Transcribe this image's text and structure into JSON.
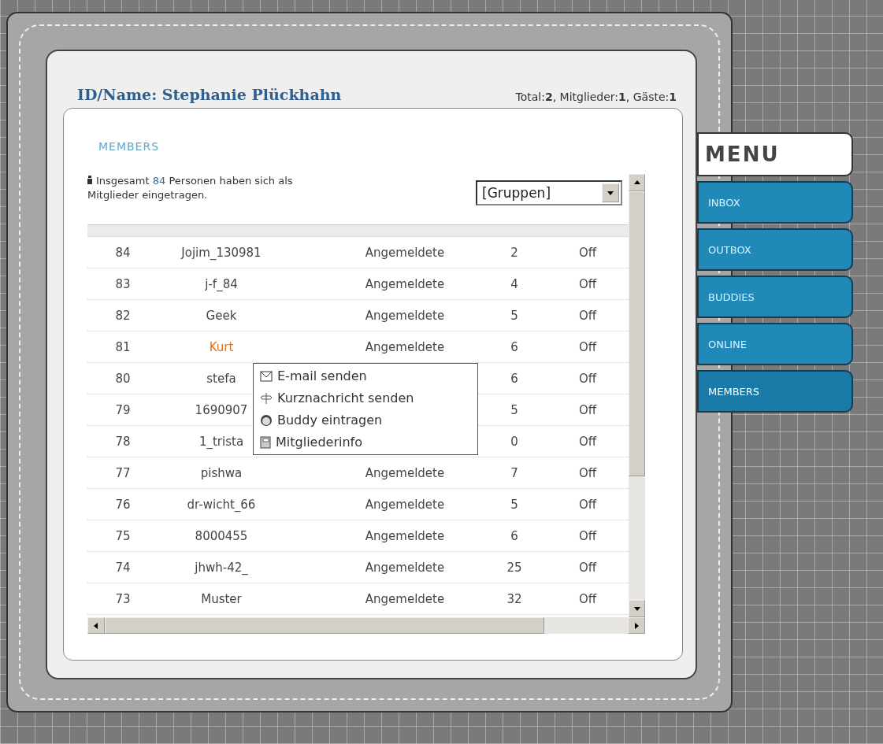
{
  "header": {
    "title": "ID/Name: Stephanie Plückhahn",
    "stats": "Total:**2**, Mitglieder:**1**, Gäste:**1**"
  },
  "section_title": "MEMBERS",
  "summary": {
    "before": "Insgesamt ",
    "count": "84",
    "after": " Personen haben sich als Mitglieder eingetragen."
  },
  "group_select": {
    "value": "[Gruppen]"
  },
  "rows": [
    {
      "id": "84",
      "name": "Jojim_130981",
      "status": "Angemeldete",
      "count": "2",
      "online": "Off",
      "highlighted": false
    },
    {
      "id": "83",
      "name": "j-f_84",
      "status": "Angemeldete",
      "count": "4",
      "online": "Off",
      "highlighted": false
    },
    {
      "id": "82",
      "name": "Geek",
      "status": "Angemeldete",
      "count": "5",
      "online": "Off",
      "highlighted": false
    },
    {
      "id": "81",
      "name": "Kurt",
      "status": "Angemeldete",
      "count": "6",
      "online": "Off",
      "highlighted": true
    },
    {
      "id": "80",
      "name": "stefa",
      "count": "6",
      "online": "Off",
      "highlighted": false
    },
    {
      "id": "79",
      "name": "1690907",
      "count": "5",
      "online": "Off",
      "highlighted": false
    },
    {
      "id": "78",
      "name": "1_trista",
      "count": "0",
      "online": "Off",
      "highlighted": false
    },
    {
      "id": "77",
      "name": "pishwa",
      "status": "Angemeldete",
      "count": "7",
      "online": "Off",
      "highlighted": false
    },
    {
      "id": "76",
      "name": "dr-wicht_66",
      "status": "Angemeldete",
      "count": "5",
      "online": "Off",
      "highlighted": false
    },
    {
      "id": "75",
      "name": "8000455",
      "status": "Angemeldete",
      "count": "6",
      "online": "Off",
      "highlighted": false
    },
    {
      "id": "74",
      "name": "jhwh-42_",
      "status": "Angemeldete",
      "count": "25",
      "online": "Off",
      "highlighted": false
    },
    {
      "id": "73",
      "name": "Muster",
      "status": "Angemeldete",
      "count": "32",
      "online": "Off",
      "highlighted": false
    }
  ],
  "context_menu": [
    {
      "kind": "email",
      "label": "E-mail senden"
    },
    {
      "kind": "message",
      "label": "Kurznachricht senden"
    },
    {
      "kind": "buddy",
      "label": "Buddy eintragen"
    },
    {
      "kind": "info",
      "label": "Mitgliederinfo"
    }
  ],
  "menu": {
    "title": "MENU",
    "items": [
      {
        "label": "INBOX",
        "selected": false
      },
      {
        "label": "OUTBOX",
        "selected": false
      },
      {
        "label": "BUDDIES",
        "selected": false
      },
      {
        "label": "ONLINE",
        "selected": false
      },
      {
        "label": "MEMBERS",
        "selected": true
      }
    ]
  }
}
